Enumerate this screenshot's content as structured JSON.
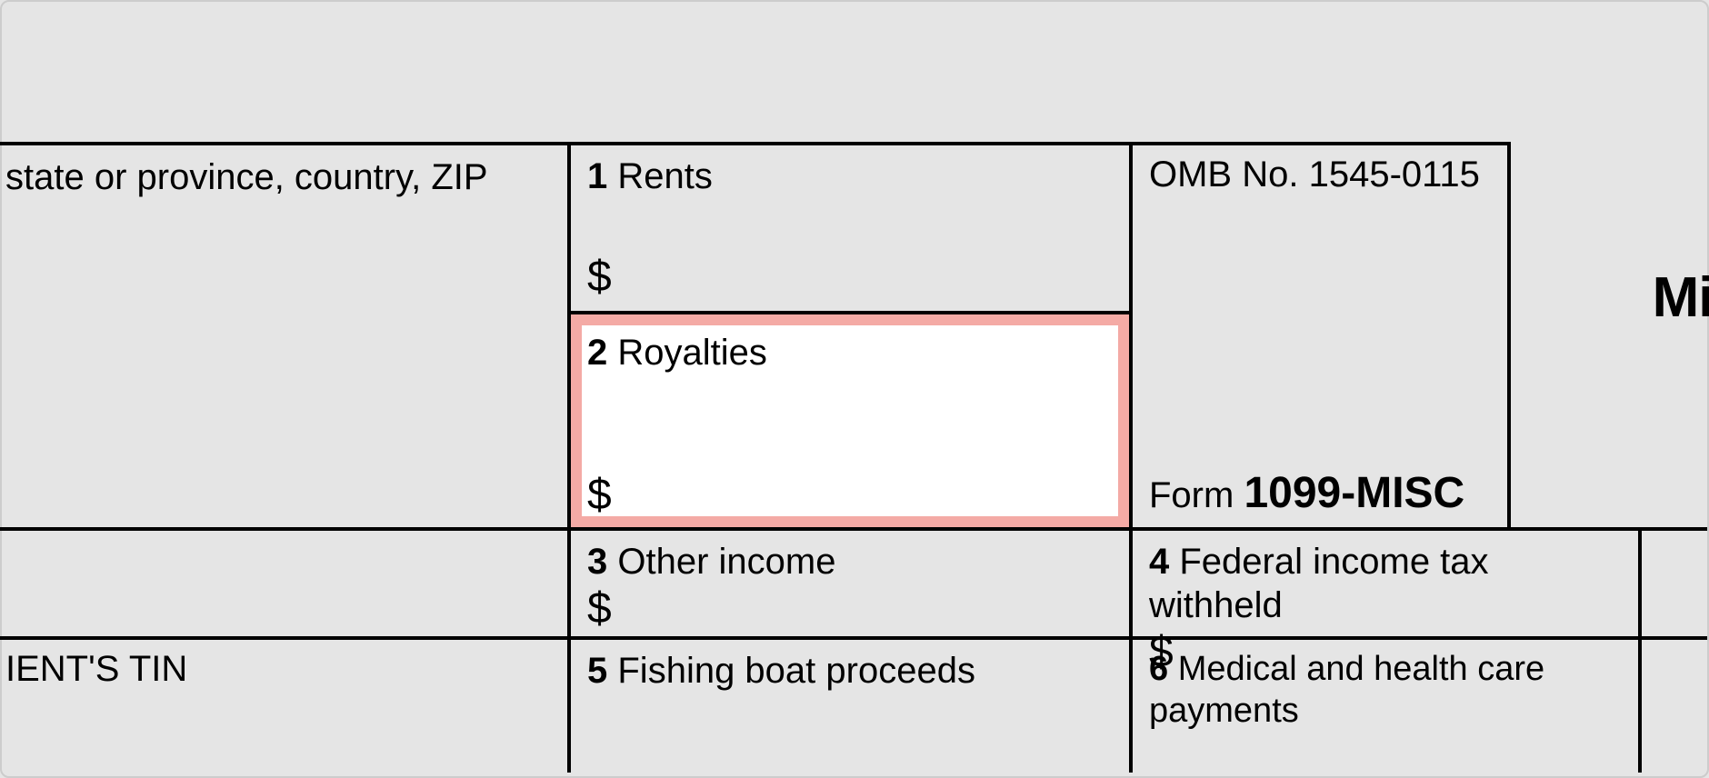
{
  "form": {
    "address_label": "state or province, country, ZIP",
    "boxes": {
      "box1": {
        "num": "1",
        "label": "Rents",
        "dollar": "$"
      },
      "box2": {
        "num": "2",
        "label": "Royalties",
        "dollar": "$"
      },
      "box3": {
        "num": "3",
        "label": "Other income",
        "dollar": "$"
      },
      "box4": {
        "num": "4",
        "label": "Federal income tax withheld",
        "dollar": "$"
      },
      "box5": {
        "num": "5",
        "label": "Fishing boat proceeds"
      },
      "box6": {
        "num": "6",
        "label": "Medical and health care payments"
      }
    },
    "omb": "OMB No. 1545-0115",
    "form_label": "Form",
    "form_number": "1099-MISC",
    "tin_label": "IENT'S TIN",
    "title_fragment": "Mis"
  }
}
